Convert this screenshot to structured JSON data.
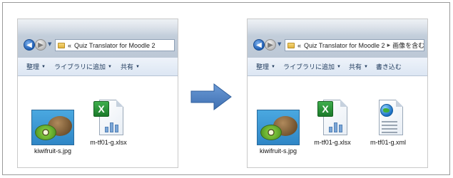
{
  "left_window": {
    "address": {
      "chevron": "«",
      "path": "Quiz Translator for Moodle 2"
    },
    "toolbar": [
      {
        "label": "整理",
        "has_dropdown": true
      },
      {
        "label": "ライブラリに追加",
        "has_dropdown": true
      },
      {
        "label": "共有",
        "has_dropdown": true
      }
    ],
    "files": [
      {
        "name": "kiwifruit-s.jpg",
        "icon": "kiwi-image-thumbnail"
      },
      {
        "name": "m-tf01-g.xlsx",
        "icon": "excel-file-icon"
      }
    ]
  },
  "right_window": {
    "address": {
      "chevron": "«",
      "path": "Quiz Translator for Moodle 2",
      "separator": "▸",
      "subfolder": "画像を含むデ"
    },
    "toolbar": [
      {
        "label": "整理",
        "has_dropdown": true
      },
      {
        "label": "ライブラリに追加",
        "has_dropdown": true
      },
      {
        "label": "共有",
        "has_dropdown": true
      },
      {
        "label": "書き込む",
        "has_dropdown": false
      }
    ],
    "files": [
      {
        "name": "kiwifruit-s.jpg",
        "icon": "kiwi-image-thumbnail"
      },
      {
        "name": "m-tf01-g.xlsx",
        "icon": "excel-file-icon"
      },
      {
        "name": "m-tf01-g.xml",
        "icon": "xml-file-icon"
      }
    ]
  },
  "colors": {
    "arrow": "#4a7ec0",
    "arrow_dark": "#2f5e9c"
  }
}
